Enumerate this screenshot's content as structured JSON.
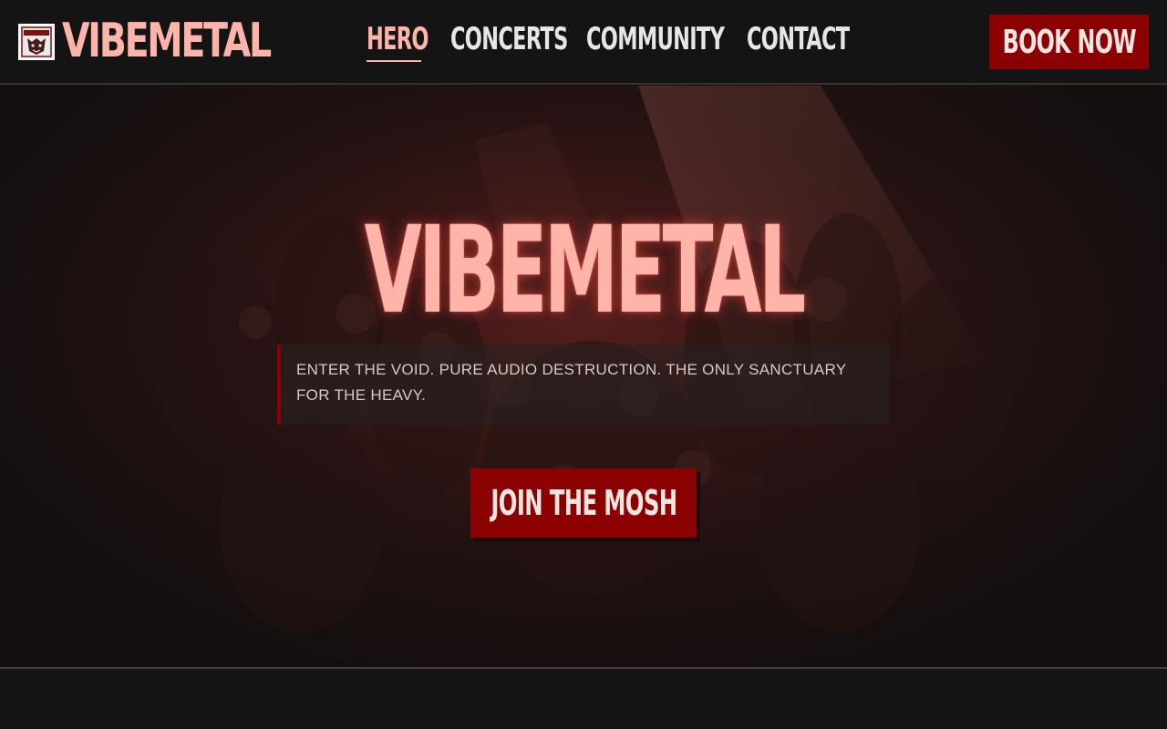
{
  "header": {
    "logo_icon": "demon-crest-icon",
    "brand": "VIBEMETAL",
    "nav": [
      {
        "label": "HERO",
        "active": true
      },
      {
        "label": "CONCERTS",
        "active": false
      },
      {
        "label": "COMMUNITY",
        "active": false
      },
      {
        "label": "CONTACT",
        "active": false
      }
    ],
    "cta_label": "BOOK NOW"
  },
  "hero": {
    "title": "VIBEMETAL",
    "tagline": "ENTER THE VOID. PURE AUDIO DESTRUCTION. THE ONLY SANCTUARY FOR THE HEAVY.",
    "cta_label": "JOIN THE MOSH",
    "background": "crowd-photo"
  },
  "colors": {
    "accent": "#ffb4aa",
    "button": "#8b0000",
    "background": "#131313"
  }
}
